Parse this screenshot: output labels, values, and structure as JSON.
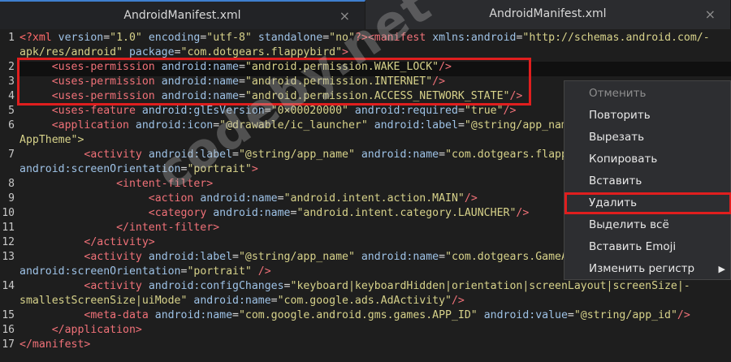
{
  "tabs": [
    {
      "title": "AndroidManifest.xml",
      "close": "×"
    },
    {
      "title": "AndroidManifest.xml",
      "close": "×"
    }
  ],
  "gutter": {
    "line_numbers": [
      "1",
      "2",
      "3",
      "4",
      "5",
      "6",
      "7",
      "8",
      "9",
      "10",
      "11",
      "12",
      "13",
      "14",
      "15",
      "16",
      "17"
    ]
  },
  "code": {
    "l1a": [
      {
        "t": "<?xml ",
        "c": "pi"
      },
      {
        "t": "version",
        "c": "attr"
      },
      {
        "t": "=",
        "c": "txt"
      },
      {
        "t": "\"1.0\"",
        "c": "str"
      },
      {
        "t": " encoding",
        "c": "attr"
      },
      {
        "t": "=",
        "c": "txt"
      },
      {
        "t": "\"utf-8\"",
        "c": "str"
      },
      {
        "t": " standalone",
        "c": "attr"
      },
      {
        "t": "=",
        "c": "txt"
      },
      {
        "t": "\"no\"",
        "c": "str"
      },
      {
        "t": "?>",
        "c": "pi"
      },
      {
        "t": "<manifest ",
        "c": "tag"
      },
      {
        "t": "xmlns:android",
        "c": "attr"
      },
      {
        "t": "=",
        "c": "txt"
      },
      {
        "t": "\"http://schemas.android.com/-",
        "c": "str"
      }
    ],
    "l1b": [
      {
        "t": "apk/res/android\"",
        "c": "str"
      },
      {
        "t": " package",
        "c": "attr"
      },
      {
        "t": "=",
        "c": "txt"
      },
      {
        "t": "\"com.dotgears.flappybird\"",
        "c": "str"
      },
      {
        "t": ">",
        "c": "tag"
      }
    ],
    "l2": [
      {
        "t": "     ",
        "c": "txt"
      },
      {
        "t": "<uses-permission ",
        "c": "tag"
      },
      {
        "t": "android:name",
        "c": "attr"
      },
      {
        "t": "=",
        "c": "txt"
      },
      {
        "t": "\"android.permission.WAKE_LOCK\"",
        "c": "str"
      },
      {
        "t": "/>",
        "c": "tag"
      }
    ],
    "l3": [
      {
        "t": "     ",
        "c": "txt"
      },
      {
        "t": "<uses-permission ",
        "c": "tag"
      },
      {
        "t": "android:name",
        "c": "attr"
      },
      {
        "t": "=",
        "c": "txt"
      },
      {
        "t": "\"android.permission.INTERNET\"",
        "c": "str"
      },
      {
        "t": "/>",
        "c": "tag"
      }
    ],
    "l4": [
      {
        "t": "     ",
        "c": "txt"
      },
      {
        "t": "<uses-permission ",
        "c": "tag"
      },
      {
        "t": "android:name",
        "c": "attr"
      },
      {
        "t": "=",
        "c": "txt"
      },
      {
        "t": "\"android.permission.ACCESS_NETWORK_STATE\"",
        "c": "str"
      },
      {
        "t": "/>",
        "c": "tag"
      }
    ],
    "l5": [
      {
        "t": "     ",
        "c": "txt"
      },
      {
        "t": "<uses-feature ",
        "c": "tag"
      },
      {
        "t": "android:glEsVersion",
        "c": "attr"
      },
      {
        "t": "=",
        "c": "txt"
      },
      {
        "t": "\"0×00020000\"",
        "c": "str"
      },
      {
        "t": " android:required",
        "c": "attr"
      },
      {
        "t": "=",
        "c": "txt"
      },
      {
        "t": "\"true\"",
        "c": "str"
      },
      {
        "t": "/>",
        "c": "tag"
      }
    ],
    "l6a": [
      {
        "t": "     ",
        "c": "txt"
      },
      {
        "t": "<application ",
        "c": "tag"
      },
      {
        "t": "android:icon",
        "c": "attr"
      },
      {
        "t": "=",
        "c": "txt"
      },
      {
        "t": "\"@drawable/ic_launcher\"",
        "c": "str"
      },
      {
        "t": " android:label",
        "c": "attr"
      },
      {
        "t": "=",
        "c": "txt"
      },
      {
        "t": "\"@string/app_name",
        "c": "str"
      }
    ],
    "l6b": [
      {
        "t": "AppTheme\">",
        "c": "str"
      }
    ],
    "l7a": [
      {
        "t": "          ",
        "c": "txt"
      },
      {
        "t": "<activity ",
        "c": "tag"
      },
      {
        "t": "android:label",
        "c": "attr"
      },
      {
        "t": "=",
        "c": "txt"
      },
      {
        "t": "\"@string/app_name\"",
        "c": "str"
      },
      {
        "t": " android:name",
        "c": "attr"
      },
      {
        "t": "=",
        "c": "txt"
      },
      {
        "t": "\"com.dotgears.flappy",
        "c": "str"
      }
    ],
    "l7b": [
      {
        "t": "android:screenOrientation",
        "c": "attr"
      },
      {
        "t": "=",
        "c": "txt"
      },
      {
        "t": "\"portrait\"",
        "c": "str"
      },
      {
        "t": ">",
        "c": "tag"
      }
    ],
    "l8": [
      {
        "t": "               ",
        "c": "txt"
      },
      {
        "t": "<intent-filter>",
        "c": "tag"
      }
    ],
    "l9": [
      {
        "t": "                    ",
        "c": "txt"
      },
      {
        "t": "<action ",
        "c": "tag"
      },
      {
        "t": "android:name",
        "c": "attr"
      },
      {
        "t": "=",
        "c": "txt"
      },
      {
        "t": "\"android.intent.action.MAIN\"",
        "c": "str"
      },
      {
        "t": "/>",
        "c": "tag"
      }
    ],
    "l10": [
      {
        "t": "                    ",
        "c": "txt"
      },
      {
        "t": "<category ",
        "c": "tag"
      },
      {
        "t": "android:name",
        "c": "attr"
      },
      {
        "t": "=",
        "c": "txt"
      },
      {
        "t": "\"android.intent.category.LAUNCHER\"",
        "c": "str"
      },
      {
        "t": "/>",
        "c": "tag"
      }
    ],
    "l11": [
      {
        "t": "               ",
        "c": "txt"
      },
      {
        "t": "</intent-filter>",
        "c": "tag"
      }
    ],
    "l12": [
      {
        "t": "          ",
        "c": "txt"
      },
      {
        "t": "</activity>",
        "c": "tag"
      }
    ],
    "l13a": [
      {
        "t": "          ",
        "c": "txt"
      },
      {
        "t": "<activity ",
        "c": "tag"
      },
      {
        "t": "android:label",
        "c": "attr"
      },
      {
        "t": "=",
        "c": "txt"
      },
      {
        "t": "\"@string/app_name\"",
        "c": "str"
      },
      {
        "t": " android:name",
        "c": "attr"
      },
      {
        "t": "=",
        "c": "txt"
      },
      {
        "t": "\"com.dotgears.GameAc",
        "c": "str"
      }
    ],
    "l13b": [
      {
        "t": "android:screenOrientation",
        "c": "attr"
      },
      {
        "t": "=",
        "c": "txt"
      },
      {
        "t": "\"portrait\"",
        "c": "str"
      },
      {
        "t": " />",
        "c": "tag"
      }
    ],
    "l14a": [
      {
        "t": "          ",
        "c": "txt"
      },
      {
        "t": "<activity ",
        "c": "tag"
      },
      {
        "t": "android:configChanges",
        "c": "attr"
      },
      {
        "t": "=",
        "c": "txt"
      },
      {
        "t": "\"keyboard|keyboardHidden|orientation|screenLayout|screenSize|-",
        "c": "str"
      }
    ],
    "l14b": [
      {
        "t": "smallestScreenSize|uiMode\"",
        "c": "str"
      },
      {
        "t": " android:name",
        "c": "attr"
      },
      {
        "t": "=",
        "c": "txt"
      },
      {
        "t": "\"com.google.ads.AdActivity\"",
        "c": "str"
      },
      {
        "t": "/>",
        "c": "tag"
      }
    ],
    "l15": [
      {
        "t": "          ",
        "c": "txt"
      },
      {
        "t": "<meta-data ",
        "c": "tag"
      },
      {
        "t": "android:name",
        "c": "attr"
      },
      {
        "t": "=",
        "c": "txt"
      },
      {
        "t": "\"com.google.android.gms.games.APP_ID\"",
        "c": "str"
      },
      {
        "t": " android:value",
        "c": "attr"
      },
      {
        "t": "=",
        "c": "txt"
      },
      {
        "t": "\"@string/app_id\"",
        "c": "str"
      },
      {
        "t": "/>",
        "c": "tag"
      }
    ],
    "l16": [
      {
        "t": "     ",
        "c": "txt"
      },
      {
        "t": "</application>",
        "c": "tag"
      }
    ],
    "l17": [
      {
        "t": "</manifest>",
        "c": "tag"
      }
    ]
  },
  "watermark": "codeby.net",
  "context_menu": {
    "items": [
      {
        "label": "Отменить",
        "disabled": true
      },
      {
        "label": "Повторить"
      },
      {
        "label": "Вырезать"
      },
      {
        "label": "Копировать"
      },
      {
        "label": "Вставить"
      },
      {
        "label": "Удалить",
        "highlighted": true
      },
      {
        "label": "Выделить всё"
      },
      {
        "label": "Вставить Emoji"
      },
      {
        "label": "Изменить регистр",
        "submenu_arrow": "▶"
      }
    ]
  },
  "colors": {
    "tag": "#f07178",
    "attribute": "#9ec2e6",
    "string": "#d7d28a",
    "processing_instruction": "#ff6a6a",
    "highlight_border": "#e01e1e",
    "active_tab_indicator": "#3f7fd0"
  }
}
